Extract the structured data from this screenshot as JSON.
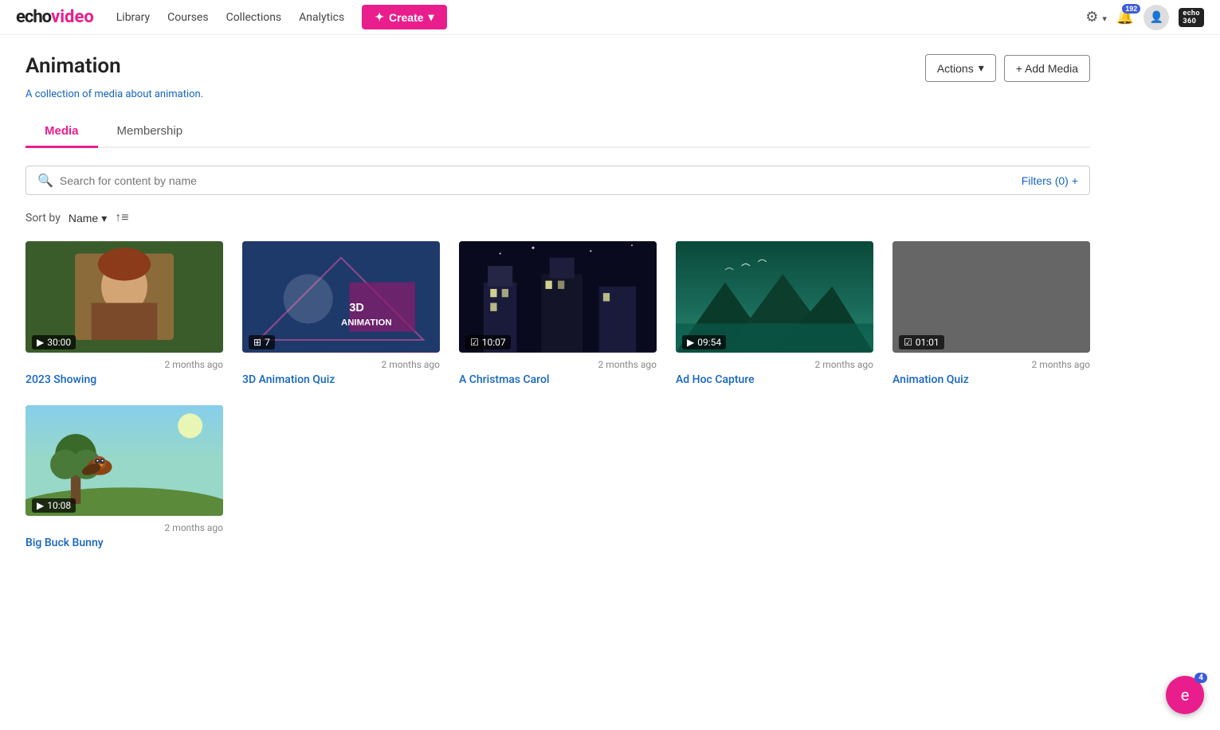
{
  "logo": {
    "echo": "echo",
    "video": "video"
  },
  "nav": {
    "links": [
      {
        "label": "Library",
        "id": "library"
      },
      {
        "label": "Courses",
        "id": "courses"
      },
      {
        "label": "Collections",
        "id": "collections"
      },
      {
        "label": "Analytics",
        "id": "analytics"
      }
    ],
    "create_label": "✦ Create",
    "notification_count": "192",
    "bottom_badge_count": "4"
  },
  "page": {
    "title": "Animation",
    "subtitle": "A collection of media about animation.",
    "actions_label": "Actions",
    "actions_chevron": "▾",
    "add_media_label": "+ Add Media"
  },
  "tabs": [
    {
      "label": "Media",
      "id": "media",
      "active": true
    },
    {
      "label": "Membership",
      "id": "membership",
      "active": false
    }
  ],
  "search": {
    "placeholder": "Search for content by name",
    "filters_label": "Filters (0)",
    "filters_plus": "+"
  },
  "sort": {
    "label": "Sort by",
    "value": "Name",
    "chevron": "▾",
    "order_icon": "↑≡"
  },
  "media_items": [
    {
      "id": "item-1",
      "name": "2023 Showing",
      "age": "2 months ago",
      "duration": "30:00",
      "type": "video",
      "thumb_class": "thumb-1",
      "thumb_type": "portrait"
    },
    {
      "id": "item-2",
      "name": "3D Animation Quiz",
      "age": "2 months ago",
      "duration": "7",
      "type": "quiz",
      "thumb_class": "thumb-2",
      "thumb_type": "text",
      "thumb_text": "3D\nANIMATION"
    },
    {
      "id": "item-3",
      "name": "A Christmas Carol",
      "age": "2 months ago",
      "duration": "10:07",
      "type": "video",
      "thumb_class": "thumb-3",
      "thumb_type": "building",
      "thumb_text": ""
    },
    {
      "id": "item-4",
      "name": "Ad Hoc Capture",
      "age": "2 months ago",
      "duration": "09:54",
      "type": "video",
      "thumb_class": "thumb-4",
      "thumb_type": "landscape",
      "thumb_text": ""
    },
    {
      "id": "item-5",
      "name": "Animation Quiz",
      "age": "2 months ago",
      "duration": "01:01",
      "type": "quiz",
      "thumb_class": "thumb-5",
      "thumb_type": "blank",
      "thumb_text": ""
    },
    {
      "id": "item-6",
      "name": "Big Buck Bunny",
      "age": "2 months ago",
      "duration": "10:08",
      "type": "video",
      "thumb_class": "thumb-6 bird-scene",
      "thumb_type": "bird",
      "thumb_text": ""
    }
  ],
  "icons": {
    "search": "🔍",
    "settings": "⚙",
    "bell": "🔔",
    "user": "👤",
    "chevron_down": "▾",
    "video_play": "▶",
    "quiz_icon": "☑",
    "sort_asc": "↑"
  }
}
